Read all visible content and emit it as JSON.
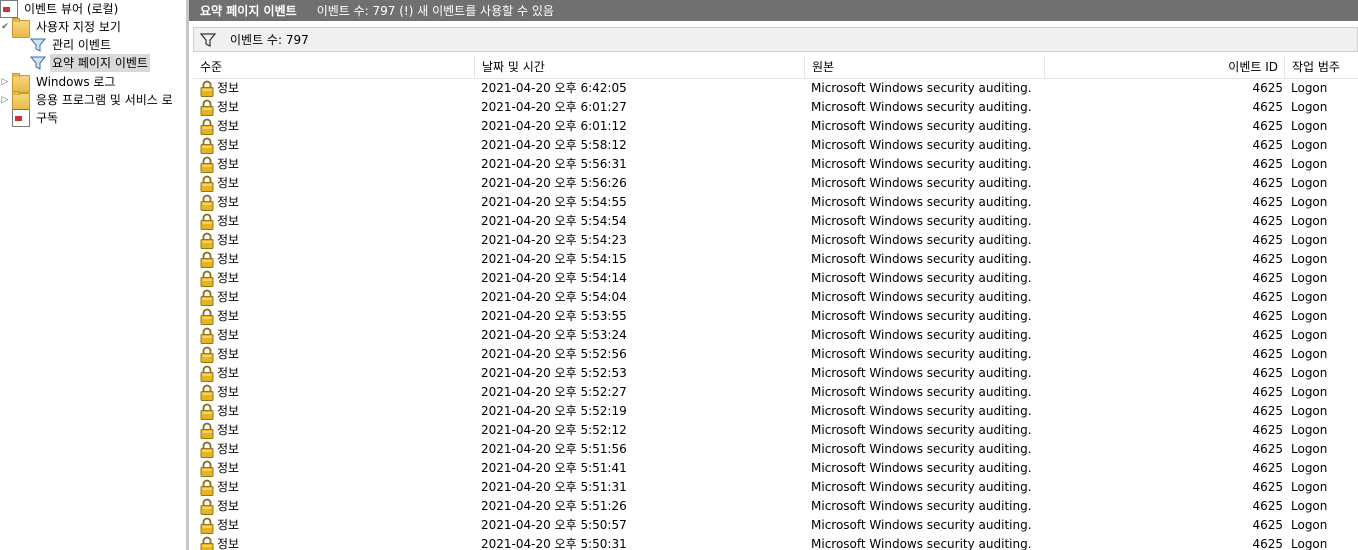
{
  "tree": {
    "root": {
      "label": "이벤트 뷰어 (로컬)"
    },
    "custom_views": {
      "label": "사용자 지정 보기"
    },
    "admin_events": {
      "label": "관리 이벤트"
    },
    "summary_events": {
      "label": "요약 페이지 이벤트"
    },
    "windows_logs": {
      "label": "Windows 로그"
    },
    "app_service_logs": {
      "label": "응용 프로그램 및 서비스 로"
    },
    "subscriptions": {
      "label": "구독"
    }
  },
  "header": {
    "title": "요약 페이지 이벤트",
    "count_text": "이벤트 수: 797 (!) 새 이벤트를 사용할 수 있음"
  },
  "filter": {
    "text": "이벤트 수: 797"
  },
  "table": {
    "columns": {
      "level": "수준",
      "date": "날짜 및 시간",
      "source": "원본",
      "event_id": "이벤트 ID",
      "category": "작업 범주"
    },
    "rows": [
      {
        "level": "정보",
        "date": "2021-04-20 오후 6:42:05",
        "source": "Microsoft Windows security auditing.",
        "event_id": "4625",
        "category": "Logon"
      },
      {
        "level": "정보",
        "date": "2021-04-20 오후 6:01:27",
        "source": "Microsoft Windows security auditing.",
        "event_id": "4625",
        "category": "Logon"
      },
      {
        "level": "정보",
        "date": "2021-04-20 오후 6:01:12",
        "source": "Microsoft Windows security auditing.",
        "event_id": "4625",
        "category": "Logon"
      },
      {
        "level": "정보",
        "date": "2021-04-20 오후 5:58:12",
        "source": "Microsoft Windows security auditing.",
        "event_id": "4625",
        "category": "Logon"
      },
      {
        "level": "정보",
        "date": "2021-04-20 오후 5:56:31",
        "source": "Microsoft Windows security auditing.",
        "event_id": "4625",
        "category": "Logon"
      },
      {
        "level": "정보",
        "date": "2021-04-20 오후 5:56:26",
        "source": "Microsoft Windows security auditing.",
        "event_id": "4625",
        "category": "Logon"
      },
      {
        "level": "정보",
        "date": "2021-04-20 오후 5:54:55",
        "source": "Microsoft Windows security auditing.",
        "event_id": "4625",
        "category": "Logon"
      },
      {
        "level": "정보",
        "date": "2021-04-20 오후 5:54:54",
        "source": "Microsoft Windows security auditing.",
        "event_id": "4625",
        "category": "Logon"
      },
      {
        "level": "정보",
        "date": "2021-04-20 오후 5:54:23",
        "source": "Microsoft Windows security auditing.",
        "event_id": "4625",
        "category": "Logon"
      },
      {
        "level": "정보",
        "date": "2021-04-20 오후 5:54:15",
        "source": "Microsoft Windows security auditing.",
        "event_id": "4625",
        "category": "Logon"
      },
      {
        "level": "정보",
        "date": "2021-04-20 오후 5:54:14",
        "source": "Microsoft Windows security auditing.",
        "event_id": "4625",
        "category": "Logon"
      },
      {
        "level": "정보",
        "date": "2021-04-20 오후 5:54:04",
        "source": "Microsoft Windows security auditing.",
        "event_id": "4625",
        "category": "Logon"
      },
      {
        "level": "정보",
        "date": "2021-04-20 오후 5:53:55",
        "source": "Microsoft Windows security auditing.",
        "event_id": "4625",
        "category": "Logon"
      },
      {
        "level": "정보",
        "date": "2021-04-20 오후 5:53:24",
        "source": "Microsoft Windows security auditing.",
        "event_id": "4625",
        "category": "Logon"
      },
      {
        "level": "정보",
        "date": "2021-04-20 오후 5:52:56",
        "source": "Microsoft Windows security auditing.",
        "event_id": "4625",
        "category": "Logon"
      },
      {
        "level": "정보",
        "date": "2021-04-20 오후 5:52:53",
        "source": "Microsoft Windows security auditing.",
        "event_id": "4625",
        "category": "Logon"
      },
      {
        "level": "정보",
        "date": "2021-04-20 오후 5:52:27",
        "source": "Microsoft Windows security auditing.",
        "event_id": "4625",
        "category": "Logon"
      },
      {
        "level": "정보",
        "date": "2021-04-20 오후 5:52:19",
        "source": "Microsoft Windows security auditing.",
        "event_id": "4625",
        "category": "Logon"
      },
      {
        "level": "정보",
        "date": "2021-04-20 오후 5:52:12",
        "source": "Microsoft Windows security auditing.",
        "event_id": "4625",
        "category": "Logon"
      },
      {
        "level": "정보",
        "date": "2021-04-20 오후 5:51:56",
        "source": "Microsoft Windows security auditing.",
        "event_id": "4625",
        "category": "Logon"
      },
      {
        "level": "정보",
        "date": "2021-04-20 오후 5:51:41",
        "source": "Microsoft Windows security auditing.",
        "event_id": "4625",
        "category": "Logon"
      },
      {
        "level": "정보",
        "date": "2021-04-20 오후 5:51:31",
        "source": "Microsoft Windows security auditing.",
        "event_id": "4625",
        "category": "Logon"
      },
      {
        "level": "정보",
        "date": "2021-04-20 오후 5:51:26",
        "source": "Microsoft Windows security auditing.",
        "event_id": "4625",
        "category": "Logon"
      },
      {
        "level": "정보",
        "date": "2021-04-20 오후 5:50:57",
        "source": "Microsoft Windows security auditing.",
        "event_id": "4625",
        "category": "Logon"
      },
      {
        "level": "정보",
        "date": "2021-04-20 오후 5:50:31",
        "source": "Microsoft Windows security auditing.",
        "event_id": "4625",
        "category": "Logon"
      }
    ]
  },
  "icons": {
    "event_row": "lock-icon",
    "filter": "filter-icon"
  }
}
